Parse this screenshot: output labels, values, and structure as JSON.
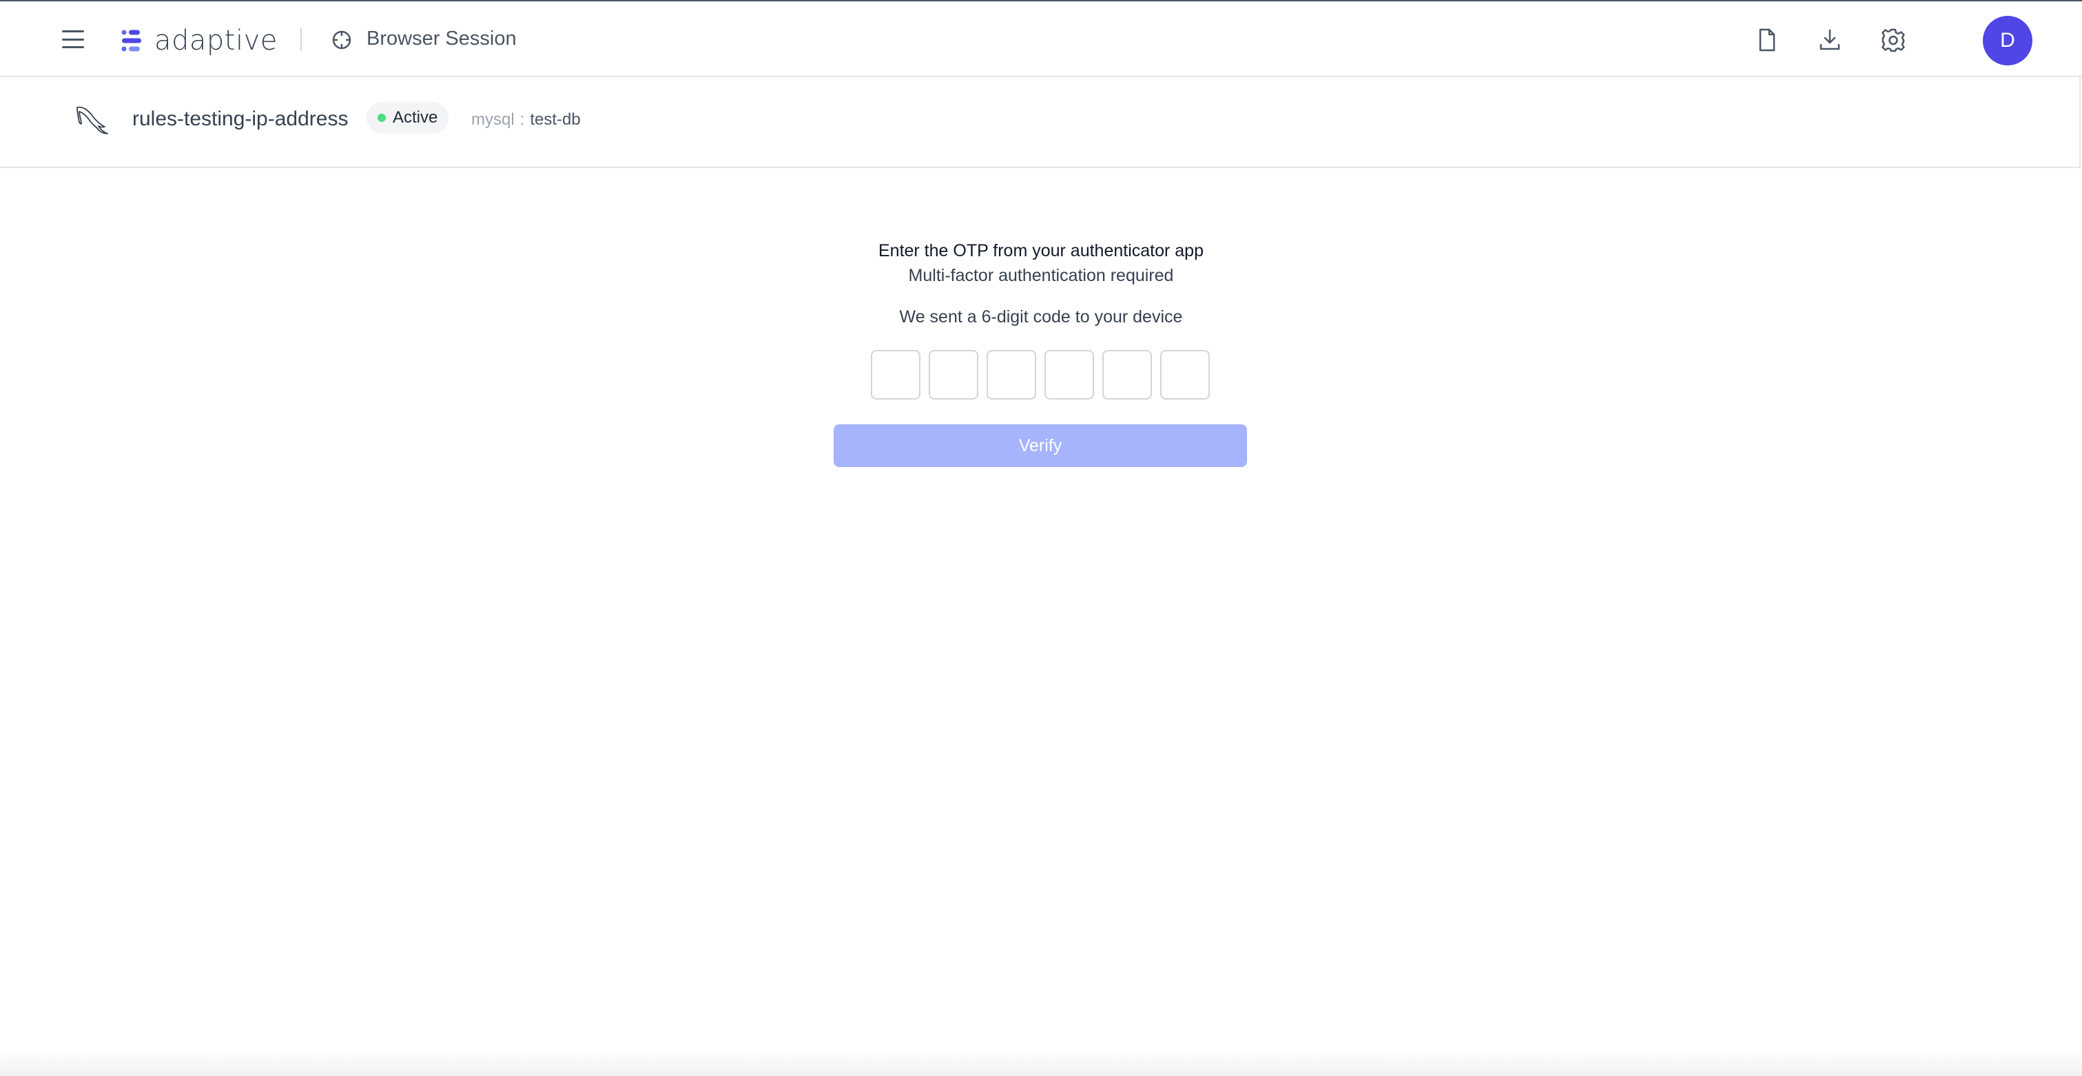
{
  "header": {
    "brand": "adaptive",
    "session_label": "Browser Session",
    "icons": [
      "menu-icon",
      "document-icon",
      "download-icon",
      "gear-icon"
    ],
    "avatar_initial": "D",
    "avatar_color": "#4f46e5",
    "brand_color": "#4f46e5"
  },
  "resource": {
    "name": "rules-testing-ip-address",
    "status": "Active",
    "status_color": "#4ade80",
    "db_type": "mysql",
    "separator": ":",
    "db_name": "test-db",
    "icon": "mysql-dolphin-icon"
  },
  "otp": {
    "title": "Enter the OTP from your authenticator app",
    "subtitle": "Multi-factor authentication required",
    "sent_message": "We sent a 6-digit code to your device",
    "digits": [
      "",
      "",
      "",
      "",
      "",
      ""
    ],
    "verify_label": "Verify",
    "verify_color": "#a5b4fc"
  }
}
